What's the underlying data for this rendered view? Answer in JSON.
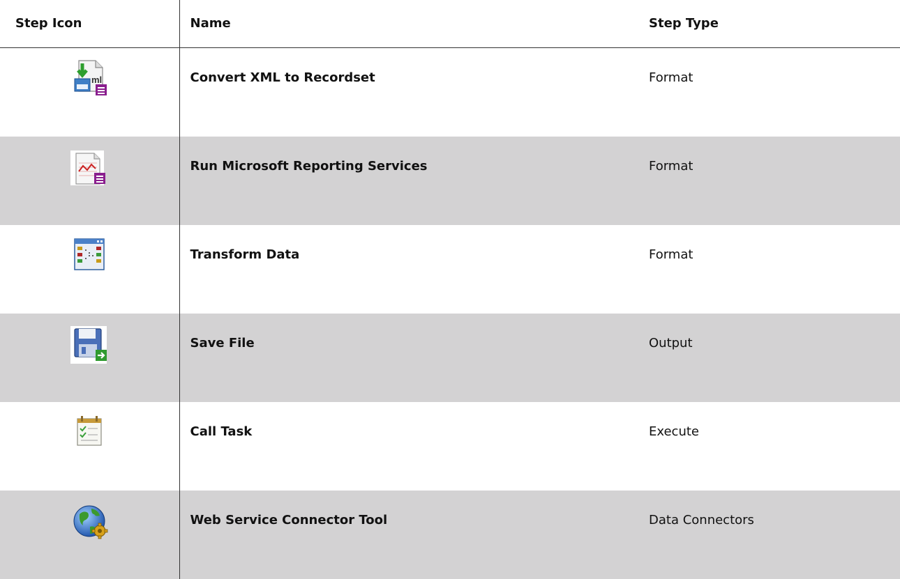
{
  "table": {
    "headers": {
      "icon": "Step Icon",
      "name": "Name",
      "type": "Step Type"
    },
    "rows": [
      {
        "name": "Convert XML to Recordset",
        "type": "Format",
        "icon": "xml-recordset-icon"
      },
      {
        "name": "Run Microsoft Reporting Services",
        "type": "Format",
        "icon": "report-icon"
      },
      {
        "name": "Transform Data",
        "type": "Format",
        "icon": "transform-data-icon"
      },
      {
        "name": "Save File",
        "type": "Output",
        "icon": "floppy-disk-icon"
      },
      {
        "name": "Call Task",
        "type": "Execute",
        "icon": "calendar-icon"
      },
      {
        "name": "Web Service Connector Tool",
        "type": "Data Connectors",
        "icon": "globe-gear-icon"
      }
    ]
  },
  "colors": {
    "row_shading": "#d3d2d3",
    "text": "#111111"
  }
}
